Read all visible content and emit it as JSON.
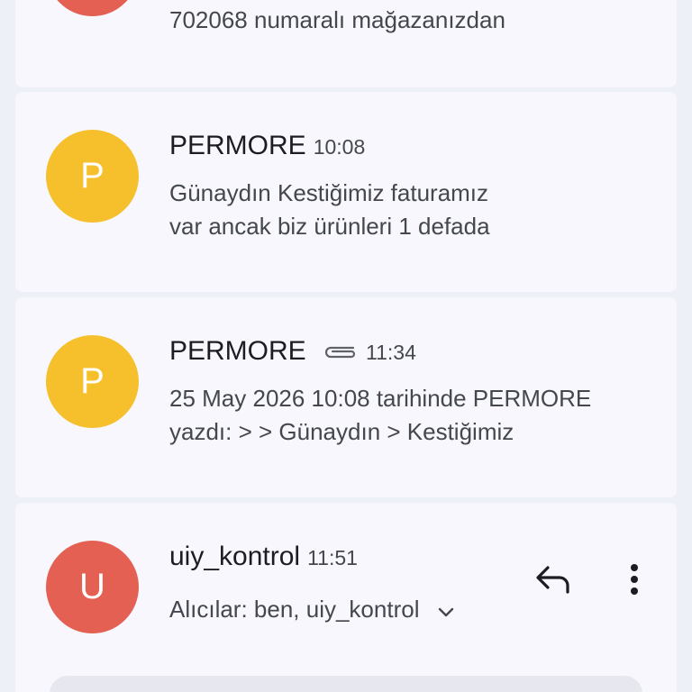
{
  "messages": [
    {
      "snippet_line2": "702068 numaralı mağazanızdan"
    },
    {
      "avatar_letter": "P",
      "sender": "PERMORE",
      "time": "10:08",
      "snippet_line1": "Günaydın Kestiğimiz faturamız",
      "snippet_line2": "var ancak biz ürünleri 1 defada"
    },
    {
      "avatar_letter": "P",
      "sender": "PERMORE",
      "time": "11:34",
      "attachment_icon": "paperclip-icon",
      "snippet_line1": "25 May 2026 10:08 tarihinde PERMORE",
      "snippet_line2": "yazdı: > > Günaydın > Kestiğimiz"
    },
    {
      "avatar_letter": "U",
      "sender": "uiy_kontrol",
      "time": "11:51",
      "recipients": "Alıcılar: ben, uiy_kontrol"
    }
  ],
  "colors": {
    "avatar_red": "#e36052",
    "avatar_yellow": "#f5c02b",
    "background": "#eef0f8",
    "card": "#f7f7fd"
  },
  "icons": [
    "paperclip-icon",
    "chevron-down-icon",
    "reply-icon",
    "more-vert-icon"
  ]
}
